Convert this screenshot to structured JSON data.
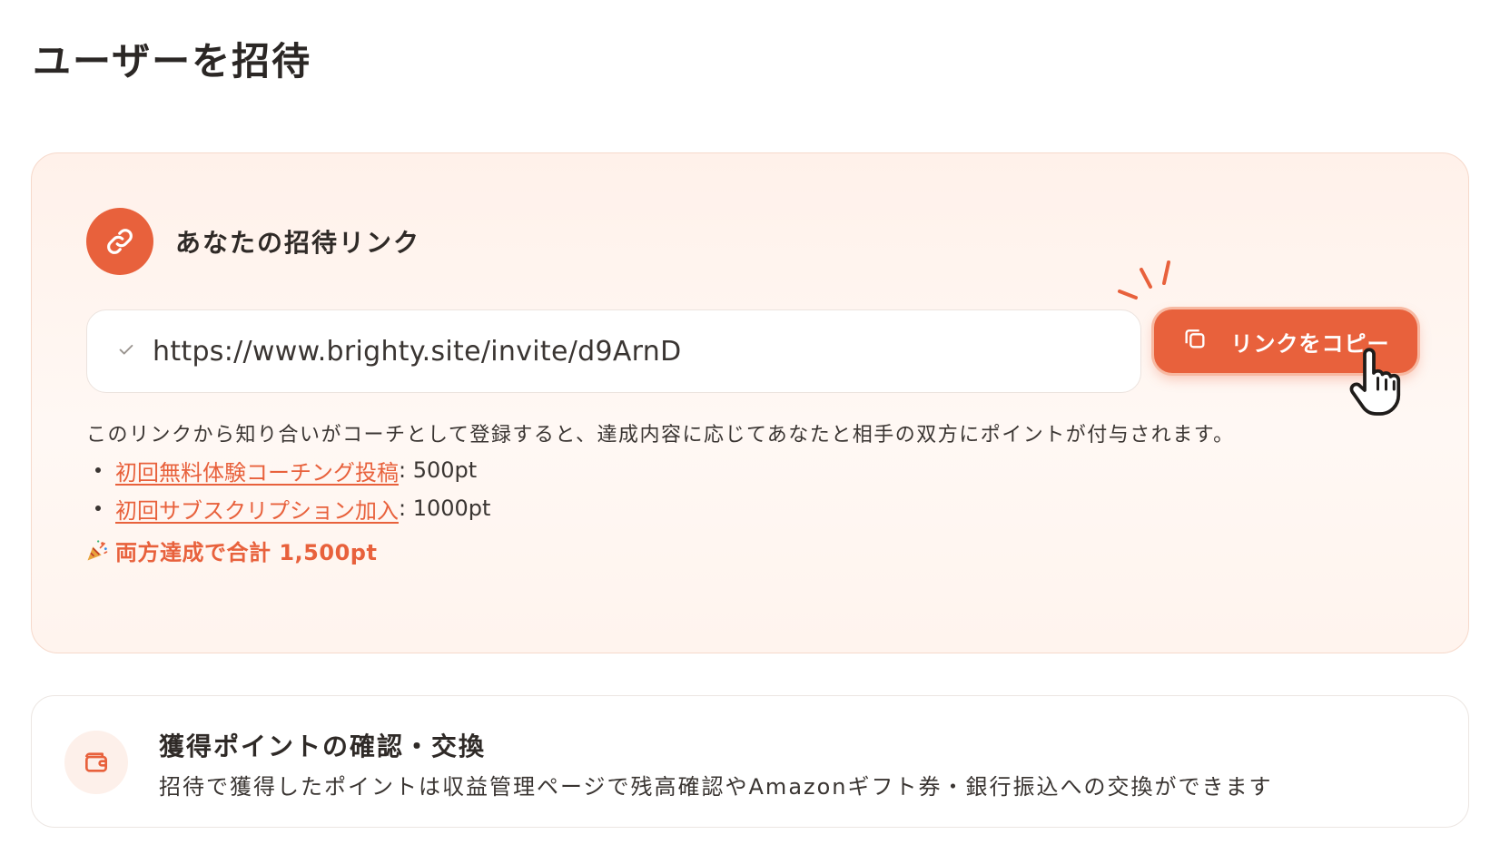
{
  "page": {
    "title": "ユーザーを招待"
  },
  "invite": {
    "title": "あなたの招待リンク",
    "url": "https://www.brighty.site/invite/d9ArnD",
    "copy_label": "リンクをコピー",
    "description": "このリンクから知り合いがコーチとして登録すると、達成内容に応じてあなたと相手の双方にポイントが付与されます。",
    "rewards": [
      {
        "label": "初回無料体験コーチング投稿",
        "value": ": 500pt"
      },
      {
        "label": "初回サブスクリプション加入",
        "value": ": 1000pt"
      }
    ],
    "total": "両方達成で合計 1,500pt"
  },
  "points": {
    "title": "獲得ポイントの確認・交換",
    "description": "招待で獲得したポイントは収益管理ページで残高確認やAmazonギフト券・銀行振込への交換ができます"
  },
  "colors": {
    "accent": "#e8613c",
    "card_bg": "#fff4ee",
    "text": "#2f2a27"
  },
  "icons": [
    "link-icon",
    "check-icon",
    "copy-icon",
    "pointer-hand-icon",
    "party-popper-icon",
    "wallet-icon"
  ]
}
